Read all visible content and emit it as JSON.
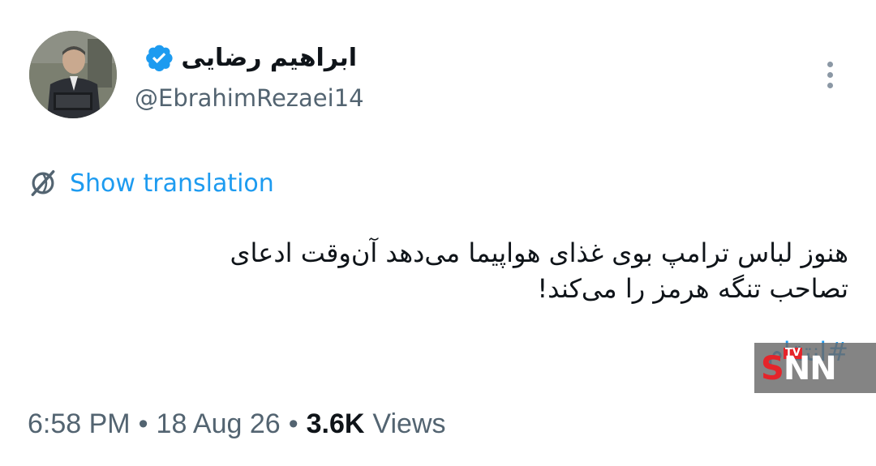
{
  "author": {
    "display_name": "ابراهیم رضایی",
    "handle": "@EbrahimRezaei14",
    "verified": true
  },
  "translate": {
    "label": "Show translation"
  },
  "tweet": {
    "lines": [
      "هنوز لباس ترامپ بوی غذای هواپیما می‌دهد آن‌وقت ادعای",
      "تصاحب تنگه هرمز را می‌کند!"
    ],
    "hashtag": "#انتقام"
  },
  "meta": {
    "time": "6:58 PM",
    "sep1": "•",
    "date": "18 Aug 26",
    "sep2": "•",
    "views_count": "3.6K",
    "views_label": "Views"
  },
  "watermark": {
    "s": "S",
    "nn": "NN",
    "tv": "TV"
  },
  "colors": {
    "accent": "#1d9bf0",
    "text": "#0f1419",
    "muted": "#536471",
    "watermark_red": "#e5242a"
  },
  "icons": {
    "verified": "verified-badge-icon",
    "more": "more-vertical-icon",
    "translate": "translate-globe-icon"
  }
}
